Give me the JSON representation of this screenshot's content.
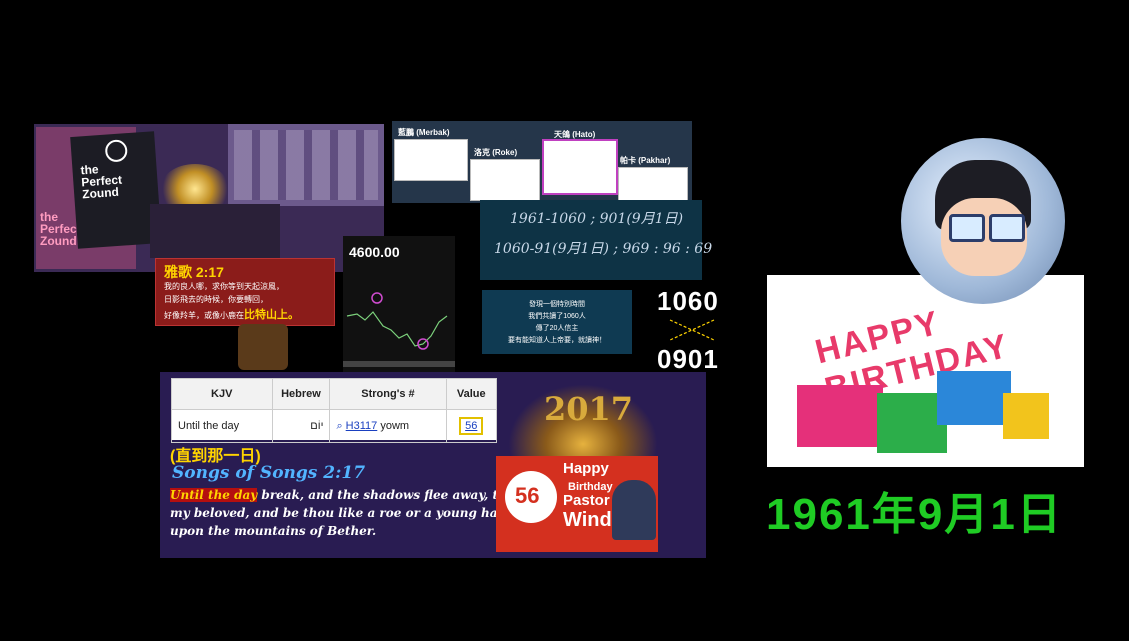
{
  "book": {
    "cover_line1": "the",
    "cover_line2": "Perfect",
    "cover_line3": "Zound",
    "cover_line4": "the",
    "cover_line5": "Perfect",
    "cover_line6": "Zound"
  },
  "song_card": {
    "title": "雅歌 2:17",
    "line1": "我的良人哪，求你等到天起涼風，",
    "line2": "日影飛去的時候，你要轉回，",
    "line3_pre": "好像羚羊，或像小鹿在",
    "line3_hl": "比特山上。"
  },
  "stock": {
    "value": "4600.00"
  },
  "tabs": {
    "t1": "藍鵬 (Merbak)",
    "t2": "洛克 (Roke)",
    "t3": "天鴿 (Hato)",
    "t4": "帕卡 (Pakhar)"
  },
  "handwriting": {
    "line1": "1961-1060 ; 901(9月1日)",
    "line2": "1060-91(9月1日) ; 969 : 96 : 69"
  },
  "message": {
    "line1": "發現一個特別時間",
    "line2": "我們共讀了1060人",
    "line3": "傳了20人信主",
    "line4": "要有能知道人上帝要，就讀神！"
  },
  "numbers": {
    "top": "1060",
    "bottom": "0901"
  },
  "table": {
    "headers": [
      "KJV",
      "Hebrew",
      "Strong's #",
      "Value"
    ],
    "row": {
      "kjv": "Until the day",
      "hebrew": "יוֹם",
      "strong_link": "H3117",
      "strong_word": "yowm",
      "value": "56"
    }
  },
  "bible": {
    "year": "2017",
    "cn_title": "(直到那一日)",
    "ref": "Songs of Songs 2:17",
    "hl": "Until the day",
    "line1_rest": " break, and the shadows flee away, turn,",
    "line2": "my beloved, and be thou like a roe or a young hart",
    "line3": "upon the mountains of Bether."
  },
  "banner": {
    "num": "56",
    "w1": "Happy",
    "w2": "Birthday",
    "w3": "Pastor",
    "w4": "Wind"
  },
  "birthday_photo": {
    "letters": "HAPPY BIRTHDAY"
  },
  "date": "1961年9月1日",
  "colors": {
    "date_green": "#1fcc24",
    "verse_blue": "#52b4ff",
    "gold": "#ffd400"
  }
}
